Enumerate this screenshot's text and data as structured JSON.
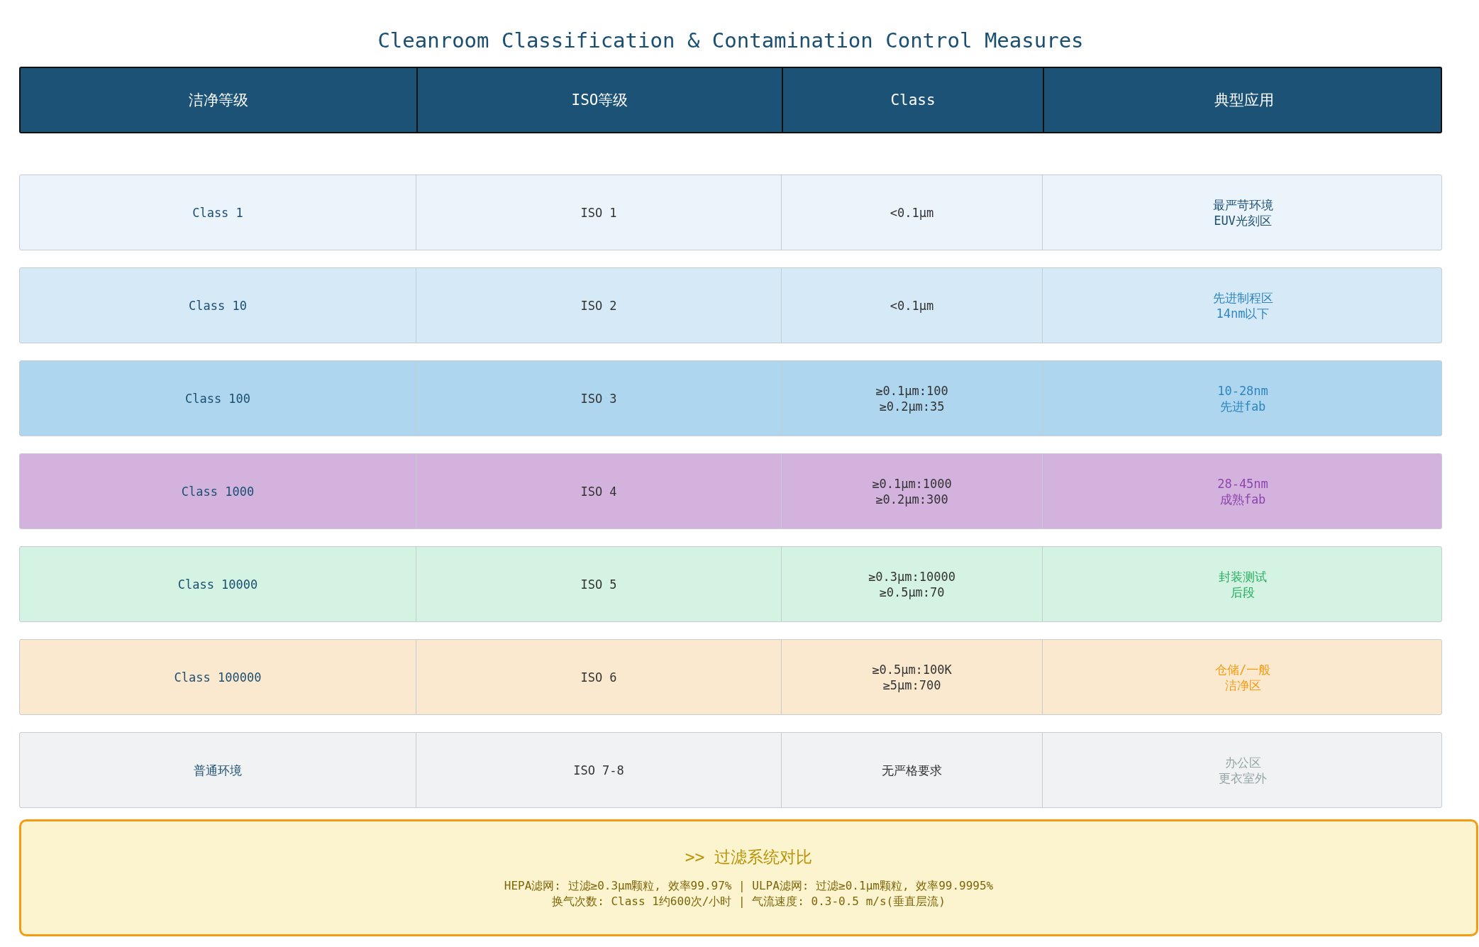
{
  "title": "Cleanroom Classification & Contamination Control Measures",
  "table": {
    "columns": [
      "洁净等级",
      "ISO等级",
      "Class",
      "典型应用"
    ],
    "rows": [
      {
        "grade": "Class 1",
        "iso": "ISO 1",
        "class": [
          "<0.1μm"
        ],
        "application": {
          "lines": [
            "最严苛环境",
            "EUV光刻区"
          ],
          "color": "#1b4f72"
        },
        "color": "#ebf3fb"
      },
      {
        "grade": "Class 10",
        "iso": "ISO 2",
        "class": [
          "<0.1μm"
        ],
        "application": {
          "lines": [
            "先进制程区",
            "14nm以下"
          ],
          "color": "#2e86c1"
        },
        "color": "#d6e9f7"
      },
      {
        "grade": "Class 100",
        "iso": "ISO 3",
        "class": [
          "≥0.1μm:100",
          "≥0.2μm:35"
        ],
        "application": {
          "lines": [
            "10-28nm",
            "先进fab"
          ],
          "color": "#2e86c1"
        },
        "color": "#aed6ef"
      },
      {
        "grade": "Class 1000",
        "iso": "ISO 4",
        "class": [
          "≥0.1μm:1000",
          "≥0.2μm:300"
        ],
        "application": {
          "lines": [
            "28-45nm",
            "成熟fab"
          ],
          "color": "#8e44ad"
        },
        "color": "#d3b3de"
      },
      {
        "grade": "Class 10000",
        "iso": "ISO 5",
        "class": [
          "≥0.3μm:10000",
          "≥0.5μm:70"
        ],
        "application": {
          "lines": [
            "封装测试",
            "后段"
          ],
          "color": "#27ae60"
        },
        "color": "#d4f3e2"
      },
      {
        "grade": "Class 100000",
        "iso": "ISO 6",
        "class": [
          "≥0.5μm:100K",
          "≥5μm:700"
        ],
        "application": {
          "lines": [
            "仓储/一般",
            "洁净区"
          ],
          "color": "#f39c12"
        },
        "color": "#fbe9cf"
      },
      {
        "grade": "普通环境",
        "iso": "ISO 7-8",
        "class": [
          "无严格要求"
        ],
        "application": {
          "lines": [
            "办公区",
            "更衣室外"
          ],
          "color": "#95a5a6"
        },
        "color": "#f1f2f4"
      }
    ]
  },
  "panel": {
    "title": ">> 过滤系统对比",
    "lines": [
      "HEPA滤网: 过滤≥0.3μm颗粒, 效率99.97% | ULPA滤网: 过滤≥0.1μm颗粒, 效率99.9995%",
      "换气次数: Class 1约600次/小时 | 气流速度: 0.3-0.5 m/s(垂直层流)"
    ]
  }
}
